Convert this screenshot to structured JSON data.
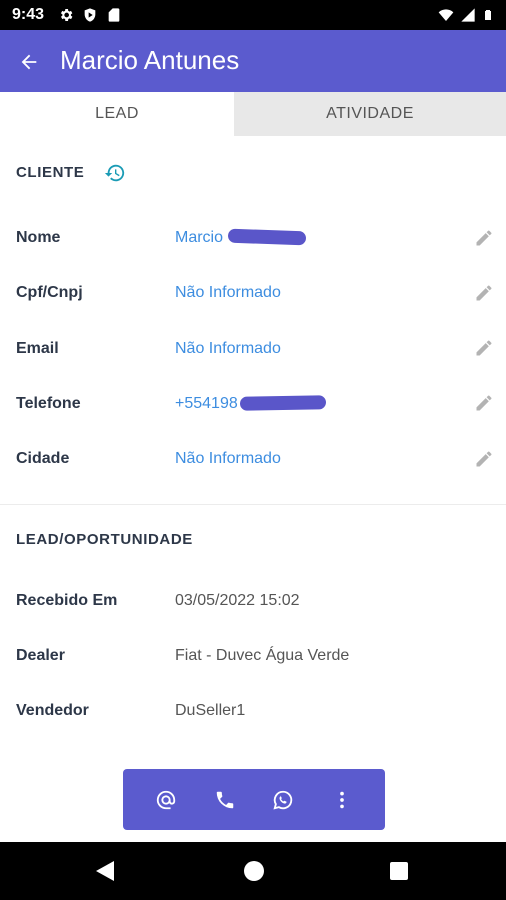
{
  "status_bar": {
    "time": "9:43",
    "left_icons": [
      "gear-icon",
      "play-shield-icon",
      "sd-card-icon"
    ],
    "right_icons": [
      "wifi-icon",
      "signal-icon",
      "battery-icon"
    ]
  },
  "appbar": {
    "title": "Marcio Antunes",
    "back_icon": "arrow-back-icon",
    "color": "#5b5bce"
  },
  "tabs": [
    {
      "label": "LEAD",
      "selected": true
    },
    {
      "label": "ATIVIDADE",
      "selected": false
    }
  ],
  "cliente": {
    "title": "CLIENTE",
    "history_icon": "history-icon",
    "rows": [
      {
        "label": "Nome",
        "value": "Marcio"
      },
      {
        "label": "Cpf/Cnpj",
        "value": "Não Informado"
      },
      {
        "label": "Email",
        "value": "Não Informado"
      },
      {
        "label": "Telefone",
        "value": "+554198"
      },
      {
        "label": "Cidade",
        "value": "Não Informado"
      }
    ]
  },
  "lead": {
    "title": "LEAD/OPORTUNIDADE",
    "rows": [
      {
        "label": "Recebido Em",
        "value": "03/05/2022 15:02"
      },
      {
        "label": "Dealer",
        "value": "Fiat - Duvec Água Verde"
      },
      {
        "label": "Vendedor",
        "value": "DuSeller1"
      }
    ]
  },
  "action_bar": {
    "buttons": [
      "at-sign-icon",
      "phone-icon",
      "whatsapp-icon",
      "more-vert-icon"
    ]
  },
  "colors": {
    "primary": "#5b5bce",
    "link": "#3d8de0",
    "accent": "#1a9bb5"
  }
}
